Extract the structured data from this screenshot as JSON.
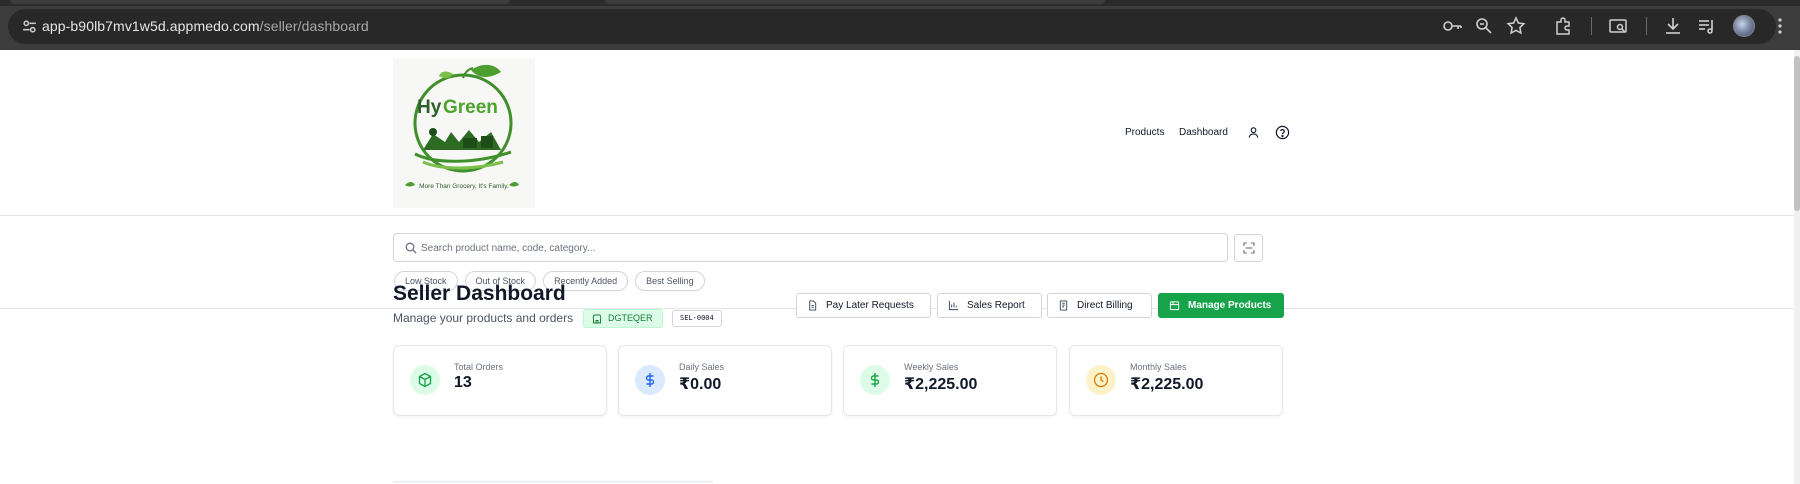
{
  "browser": {
    "url_host": "app-b90lb7mv1w5d.appmedo.com",
    "url_path": "/seller/dashboard",
    "icons": [
      "site-info-icon",
      "key-icon",
      "zoom-icon",
      "star-icon",
      "extensions-icon",
      "cast-icon",
      "download-icon",
      "media-icon",
      "profile-avatar",
      "menu-icon"
    ]
  },
  "header": {
    "logo": {
      "brand_hy": "Hy",
      "brand_green": "Green",
      "tagline": "More Than Grocery, It's Family."
    },
    "nav": {
      "products": "Products",
      "dashboard": "Dashboard",
      "icons": [
        "user-icon",
        "help-icon"
      ]
    }
  },
  "search": {
    "placeholder": "Search product name, code, category...",
    "filters": [
      "Low Stock",
      "Out of Stock",
      "Recently Added",
      "Best Selling"
    ]
  },
  "dashboard": {
    "title": "Seller Dashboard",
    "subtitle": "Manage your products and orders",
    "store_code": "DGTEQER",
    "seller_id": "SEL-0004",
    "buttons": {
      "pay_later": "Pay Later Requests",
      "sales_report": "Sales Report",
      "direct_billing": "Direct Billing",
      "manage_products": "Manage Products"
    },
    "stats": [
      {
        "label": "Total Orders",
        "value": "13",
        "icon": "box-icon"
      },
      {
        "label": "Daily Sales",
        "value": "₹0.00",
        "icon": "dollar-icon"
      },
      {
        "label": "Weekly Sales",
        "value": "₹2,225.00",
        "icon": "dollar-icon"
      },
      {
        "label": "Monthly Sales",
        "value": "₹2,225.00",
        "icon": "clock-icon"
      }
    ]
  },
  "colors": {
    "accent": "#16a34a",
    "badge_bg": "#dcfce7",
    "chrome_bg": "#3c3c3c"
  }
}
